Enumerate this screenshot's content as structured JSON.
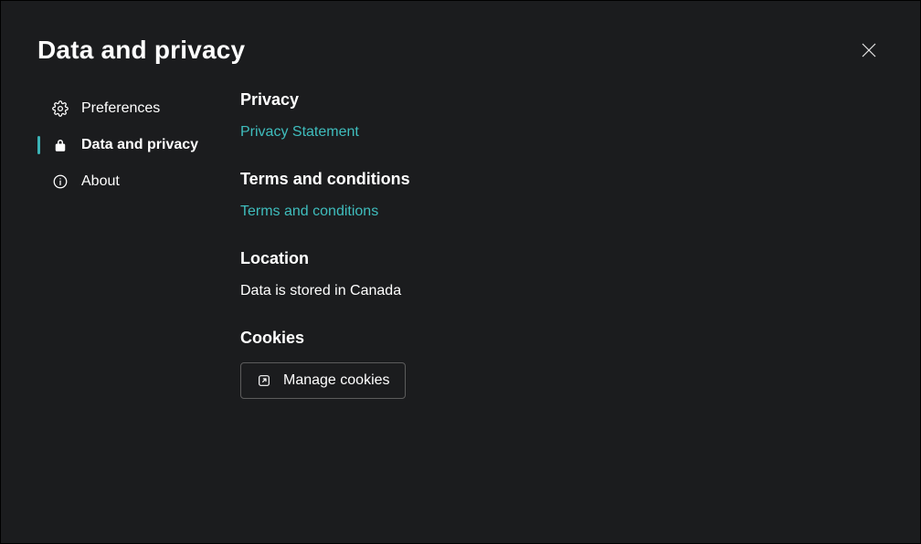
{
  "header": {
    "title": "Data and privacy"
  },
  "sidebar": {
    "items": [
      {
        "label": "Preferences"
      },
      {
        "label": "Data and privacy"
      },
      {
        "label": "About"
      }
    ]
  },
  "main": {
    "privacy": {
      "heading": "Privacy",
      "link_label": "Privacy Statement"
    },
    "terms": {
      "heading": "Terms and conditions",
      "link_label": "Terms and conditions"
    },
    "location": {
      "heading": "Location",
      "text": "Data is stored in Canada"
    },
    "cookies": {
      "heading": "Cookies",
      "button_label": "Manage cookies"
    }
  }
}
